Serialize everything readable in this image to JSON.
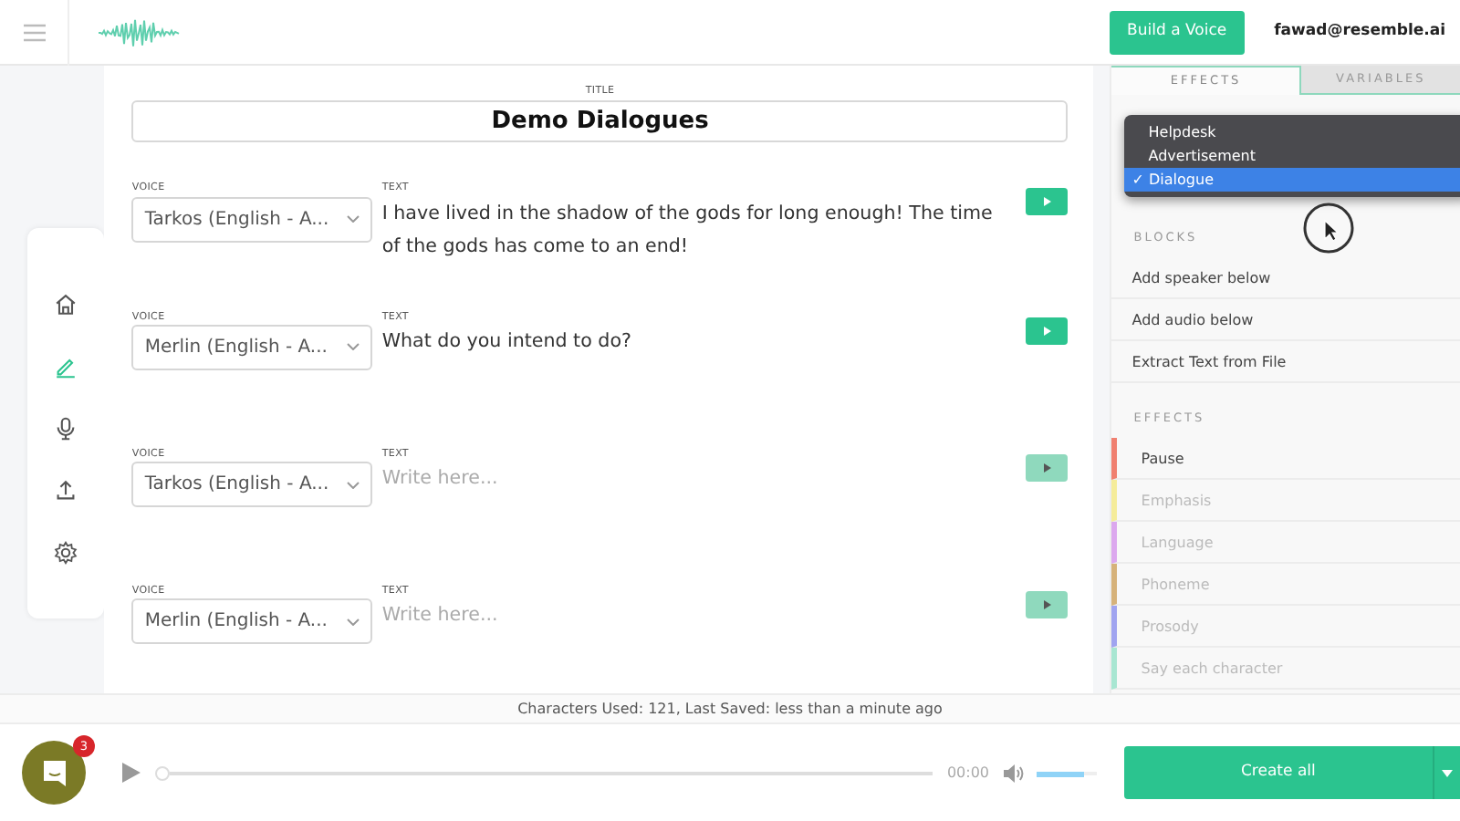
{
  "header": {
    "build_button": "Build a Voice",
    "user_email": "fawad@resemble.ai"
  },
  "sidebar": {
    "items": [
      {
        "selected": false
      },
      {
        "selected": true
      },
      {
        "selected": false
      },
      {
        "selected": false
      },
      {
        "selected": false
      }
    ]
  },
  "editor": {
    "title_label": "TITLE",
    "title": "Demo Dialogues",
    "rows": [
      {
        "voice_label": "VOICE",
        "voice": "Tarkos (English - A...",
        "text_label": "TEXT",
        "text": "I have lived in the shadow of the gods for long enough! The time of the gods has come to an end!",
        "play_disabled": false
      },
      {
        "voice_label": "VOICE",
        "voice": "Merlin (English - A...",
        "text_label": "TEXT",
        "text": "What do you intend to do?",
        "play_disabled": false
      },
      {
        "voice_label": "VOICE",
        "voice": "Tarkos (English - A...",
        "text_label": "TEXT",
        "placeholder": "Write here...",
        "play_disabled": true
      },
      {
        "voice_label": "VOICE",
        "voice": "Merlin (English - A...",
        "text_label": "TEXT",
        "placeholder": "Write here...",
        "play_disabled": true
      }
    ]
  },
  "right_panel": {
    "tabs": [
      {
        "label": "EFFECTS",
        "selected": true
      },
      {
        "label": "VARIABLES",
        "selected": false
      }
    ],
    "style_menu": [
      {
        "label": "Helpdesk",
        "selected": false
      },
      {
        "label": "Advertisement",
        "selected": false
      },
      {
        "label": "Dialogue",
        "selected": true
      }
    ],
    "check_mark": "✓",
    "blocks_heading": "BLOCKS",
    "blocks": [
      "Add speaker below",
      "Add audio below",
      "Extract Text from File"
    ],
    "effects_heading": "EFFECTS",
    "effects": [
      {
        "label": "Pause",
        "color": "#f08070",
        "disabled": false
      },
      {
        "label": "Emphasis",
        "color": "#f5ec9a",
        "disabled": true
      },
      {
        "label": "Language",
        "color": "#dca8ee",
        "disabled": true
      },
      {
        "label": "Phoneme",
        "color": "#d6b27a",
        "disabled": true
      },
      {
        "label": "Prosody",
        "color": "#a0a4f0",
        "disabled": true
      },
      {
        "label": "Say each character",
        "color": "#a8e6d2",
        "disabled": true
      }
    ]
  },
  "status_line": "Characters Used: 121, Last Saved: less than a minute ago",
  "player": {
    "chat_badge": "3",
    "progress": {
      "level": 0
    },
    "time": "00:00",
    "volume": {
      "level": 0.8
    },
    "create_button": "Create all"
  }
}
